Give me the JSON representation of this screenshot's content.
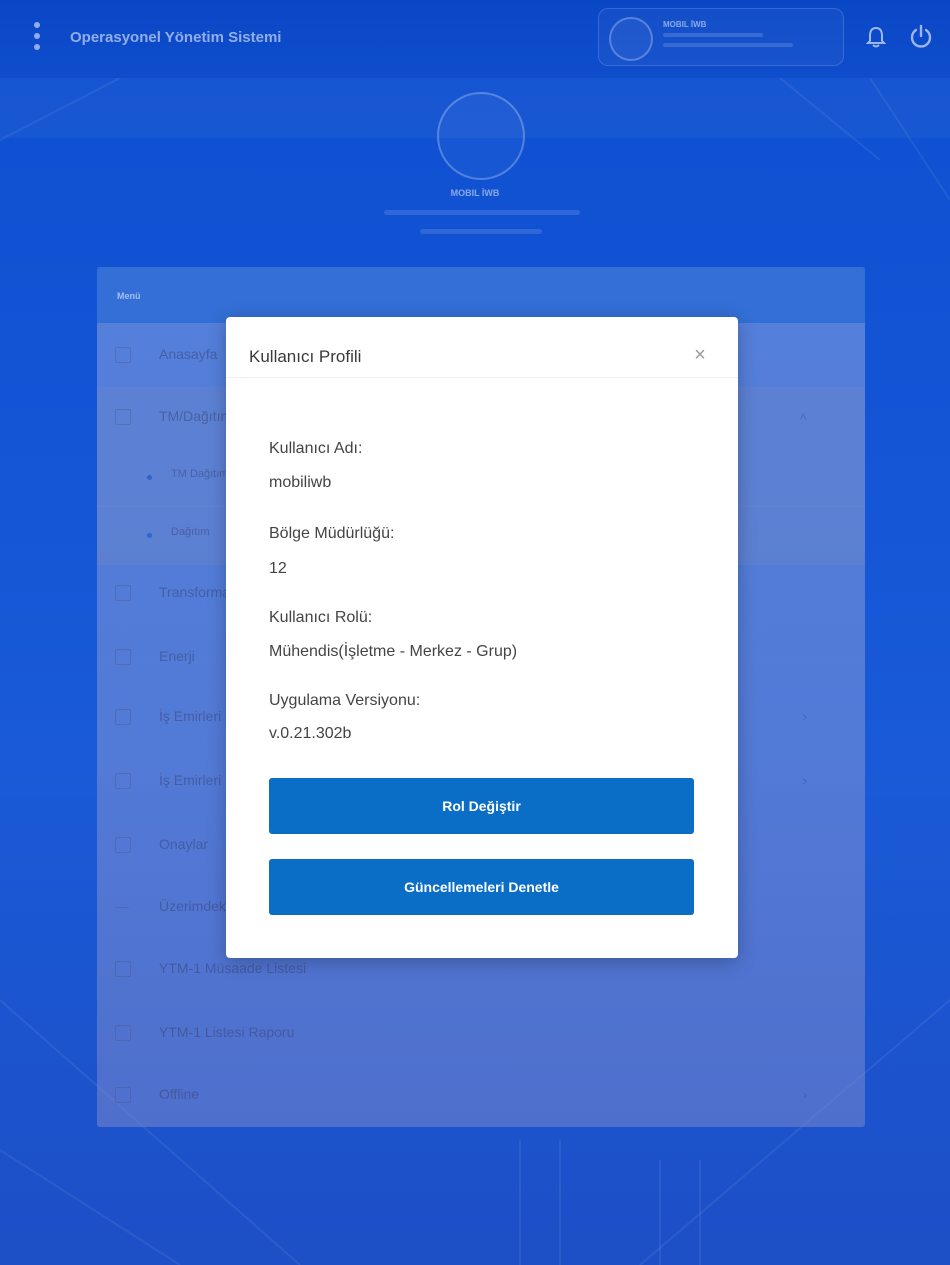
{
  "header": {
    "app_title": "Operasyonel Yönetim Sistemi",
    "user_name": "MOBIL İWB",
    "icons": [
      "kebab-menu-icon",
      "bell-icon",
      "power-icon"
    ]
  },
  "profile": {
    "name": "MOBIL İWB"
  },
  "menu": {
    "title": "Menü",
    "items": [
      {
        "label": "Anasayfa",
        "icon": "home-icon",
        "chevron": false,
        "sub": false
      },
      {
        "label": "TM/Dağıtım",
        "icon": "folder-icon",
        "chevron": true,
        "sub": false
      },
      {
        "label": "TM Dağıtım",
        "icon": "",
        "chevron": false,
        "sub": true
      },
      {
        "label": "Dağıtım",
        "icon": "",
        "chevron": false,
        "sub": true
      },
      {
        "label": "Transformatör",
        "icon": "home-icon",
        "chevron": false,
        "sub": false
      },
      {
        "label": "Enerji",
        "icon": "bolt-icon",
        "chevron": false,
        "sub": false
      },
      {
        "label": "İş Emirleri",
        "icon": "grid-icon",
        "chevron": true,
        "sub": false
      },
      {
        "label": "İş Emirleri",
        "icon": "grid-icon",
        "chevron": true,
        "sub": false
      },
      {
        "label": "Onaylar",
        "icon": "check-icon",
        "chevron": false,
        "sub": false
      },
      {
        "label": "Üzerimdeki",
        "icon": "line-icon",
        "chevron": false,
        "sub": false
      },
      {
        "label": "YTM-1 Müsaade Listesi",
        "icon": "list-icon",
        "chevron": false,
        "sub": false
      },
      {
        "label": "YTM-1 Listesi Raporu",
        "icon": "report-icon",
        "chevron": false,
        "sub": false
      },
      {
        "label": "Offline",
        "icon": "cloud-icon",
        "chevron": true,
        "sub": false
      }
    ]
  },
  "modal": {
    "title": "Kullanıcı Profili",
    "close_icon": "close-icon",
    "fields": [
      {
        "label": "Kullanıcı Adı:",
        "value": "mobiliwb"
      },
      {
        "label": "Bölge Müdürlüğü:",
        "value": "12"
      },
      {
        "label": "Kullanıcı Rolü:",
        "value": "Mühendis(İşletme - Merkez - Grup)"
      },
      {
        "label": "Uygulama Versiyonu:",
        "value": "v.0.21.302b"
      }
    ],
    "buttons": {
      "change_role": "Rol Değiştir",
      "check_updates": "Güncellemeleri Denetle"
    },
    "colors": {
      "button_bg": "#0a6ec6",
      "text": "#444444"
    }
  }
}
